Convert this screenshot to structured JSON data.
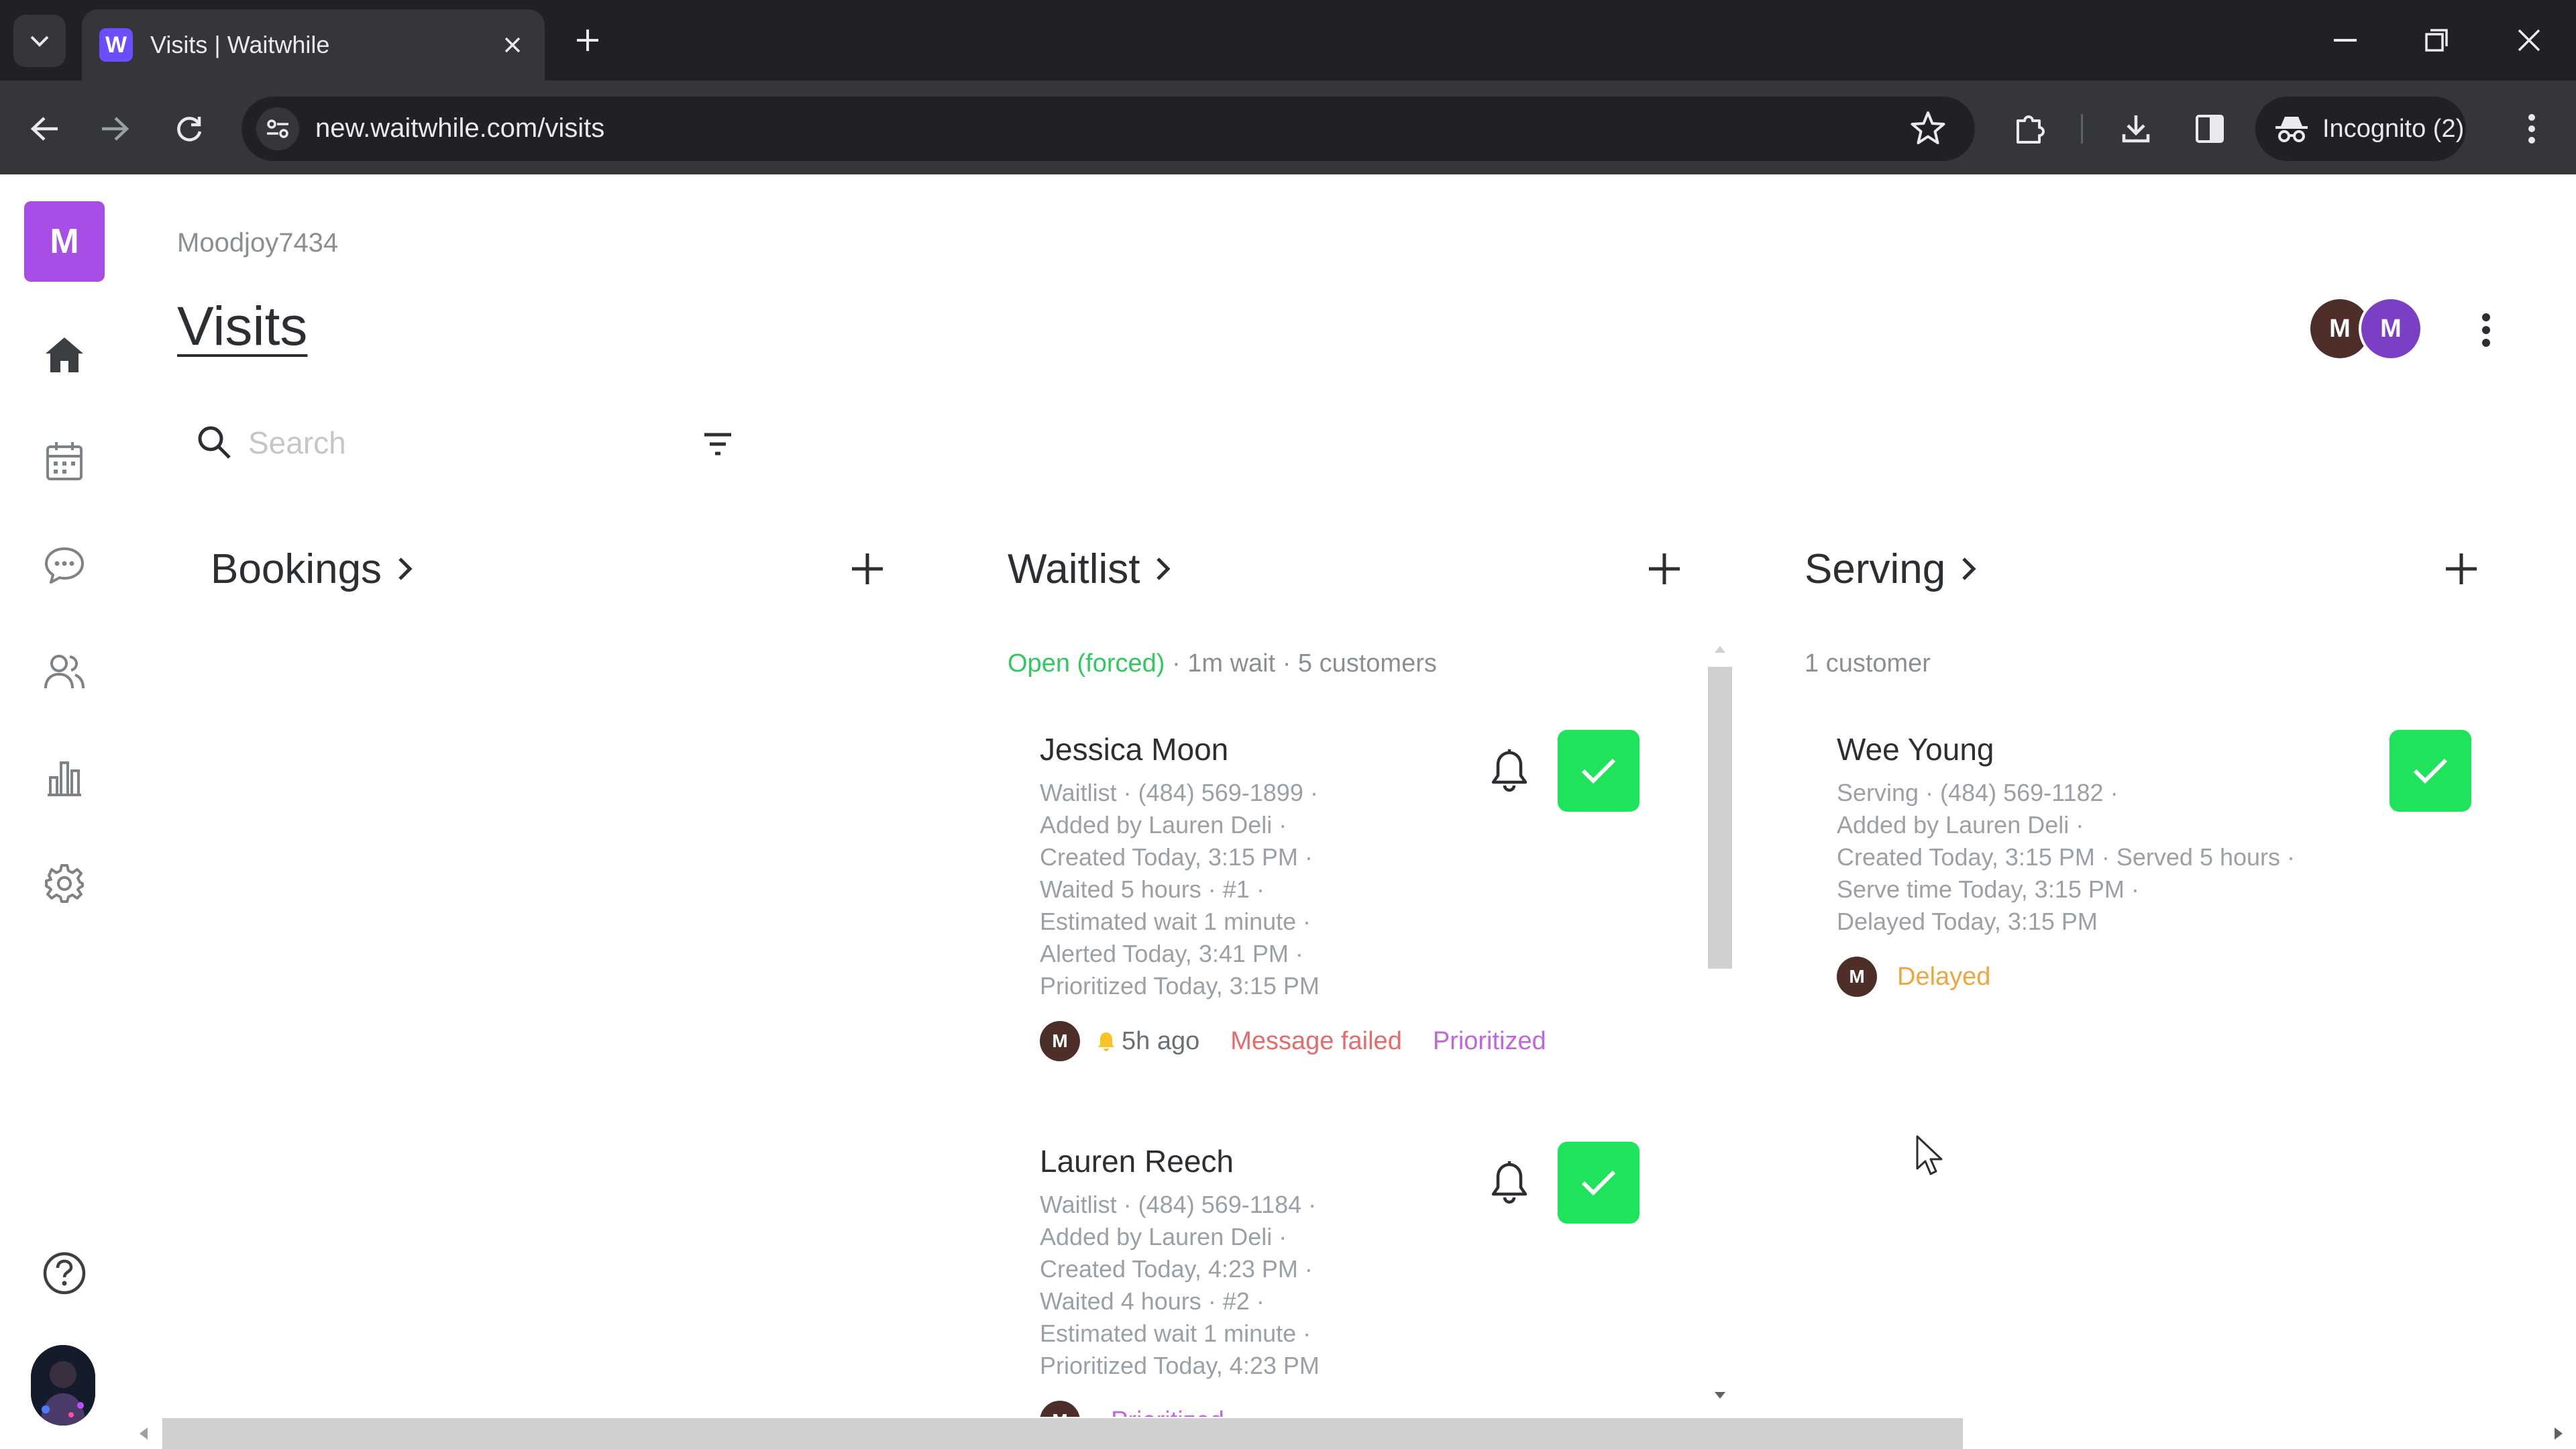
{
  "browser": {
    "tab_title": "Visits | Waitwhile",
    "favicon_letter": "W",
    "url": "new.waitwhile.com/visits",
    "incognito_label": "Incognito (2)"
  },
  "rail": {
    "org_initial": "M",
    "items": [
      {
        "name": "home",
        "icon": "home-icon"
      },
      {
        "name": "calendar",
        "icon": "calendar-icon"
      },
      {
        "name": "messages",
        "icon": "chat-icon"
      },
      {
        "name": "customers",
        "icon": "users-icon"
      },
      {
        "name": "analytics",
        "icon": "bar-chart-icon"
      },
      {
        "name": "settings",
        "icon": "gear-icon"
      }
    ],
    "help_icon": "help-icon"
  },
  "header": {
    "org_name": "Moodjoy7434",
    "title": "Visits",
    "staff_avatars": [
      "M",
      "M"
    ]
  },
  "search": {
    "placeholder": "Search"
  },
  "columns": {
    "bookings": {
      "title": "Bookings"
    },
    "waitlist": {
      "title": "Waitlist",
      "status": "Open (forced)",
      "summary": " · 1m wait · 5 customers",
      "cards": [
        {
          "name": "Jessica Moon",
          "lines": [
            "Waitlist · (484) 569-1899 ·",
            "Added by Lauren Deli ·",
            "Created Today, 3:15 PM ·",
            "Waited 5 hours · #1 ·",
            "Estimated wait 1 minute ·",
            "Alerted Today, 3:41 PM ·",
            "Prioritized Today, 3:15 PM"
          ],
          "avatar": "M",
          "time_ago": "5h ago",
          "message_status": "Message failed",
          "tag": "Prioritized"
        },
        {
          "name": "Lauren Reech",
          "lines": [
            "Waitlist · (484) 569-1184 ·",
            "Added by Lauren Deli ·",
            "Created Today, 4:23 PM ·",
            "Waited 4 hours · #2 ·",
            "Estimated wait 1 minute ·",
            "Prioritized Today, 4:23 PM"
          ],
          "avatar": "M",
          "tag": "Prioritized"
        }
      ]
    },
    "serving": {
      "title": "Serving",
      "summary": "1 customer",
      "cards": [
        {
          "name": "Wee Young",
          "lines": [
            "Serving · (484) 569-1182 ·",
            "Added by Lauren Deli ·",
            "Created Today, 3:15 PM · Served 5 hours ·",
            "Serve time Today, 3:15 PM ·",
            "Delayed Today, 3:15 PM"
          ],
          "avatar": "M",
          "tag": "Delayed"
        }
      ]
    }
  },
  "colors": {
    "accent_purple": "#a64ee6",
    "check_green": "#1fe35a",
    "open_green": "#2fc95e",
    "failed_red": "#e86a6a",
    "prioritized_purple": "#c165e0",
    "delayed_orange": "#f0a640"
  }
}
